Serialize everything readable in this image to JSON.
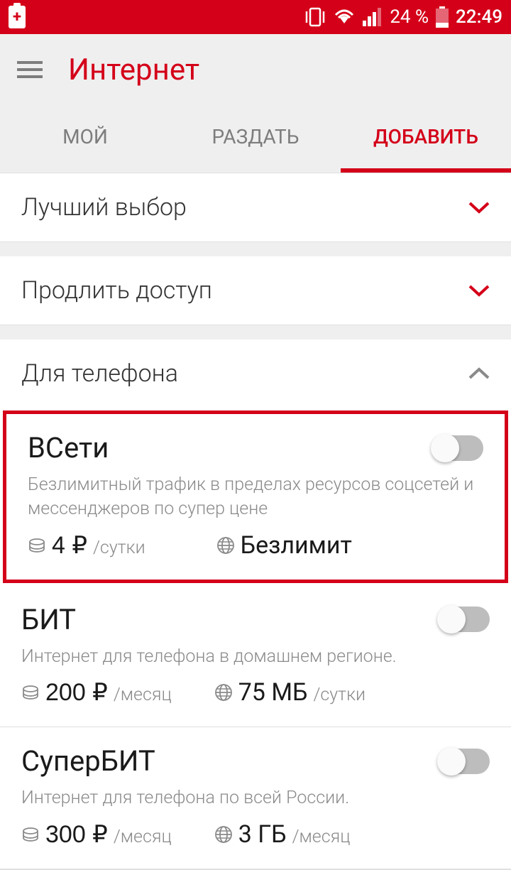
{
  "statusbar": {
    "battery_percent": "24 %",
    "time": "22:49"
  },
  "header": {
    "title": "Интернет"
  },
  "tabs": {
    "items": [
      {
        "label": "МОЙ"
      },
      {
        "label": "РАЗДАТЬ"
      },
      {
        "label": "ДОБАВИТЬ"
      }
    ]
  },
  "sections": {
    "best_choice": "Лучший выбор",
    "extend": "Продлить доступ",
    "for_phone": "Для телефона"
  },
  "options": [
    {
      "name": "ВСети",
      "desc": "Безлимитный трафик в пределах ресурсов соцсетей и мессенджеров по супер цене",
      "price_value": "4 ₽",
      "price_unit": "/сутки",
      "data_value": "Безлимит",
      "data_unit": ""
    },
    {
      "name": "БИТ",
      "desc": "Интернет для телефона в домашнем регионе.",
      "price_value": "200 ₽",
      "price_unit": "/месяц",
      "data_value": "75 МБ",
      "data_unit": "/сутки"
    },
    {
      "name": "СуперБИТ",
      "desc": "Интернет для телефона по всей России.",
      "price_value": "300 ₽",
      "price_unit": "/месяц",
      "data_value": "3 ГБ",
      "data_unit": "/месяц"
    }
  ]
}
